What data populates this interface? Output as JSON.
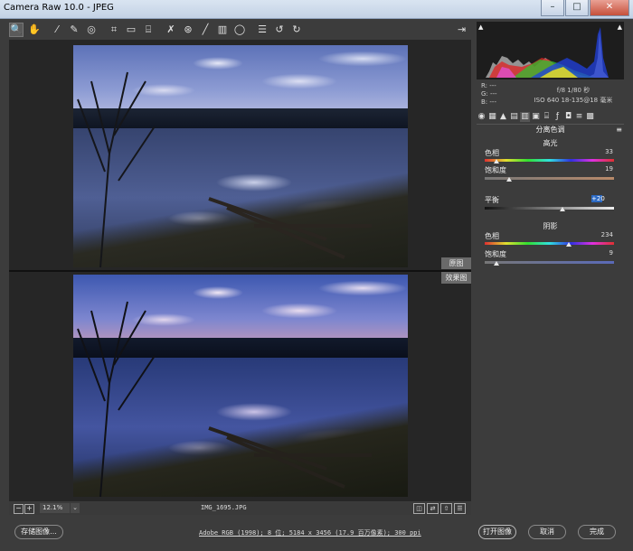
{
  "window": {
    "title": "Camera Raw 10.0 - JPEG",
    "buttons": [
      "–",
      "□",
      "✕"
    ]
  },
  "toolbar": {
    "tools": [
      {
        "name": "zoom-tool",
        "glyph": "🔍"
      },
      {
        "name": "hand-tool",
        "glyph": "✋"
      },
      {
        "name": "white-balance-tool",
        "glyph": "⁄"
      },
      {
        "name": "color-sampler-tool",
        "glyph": "✎"
      },
      {
        "name": "targeted-adjustment-tool",
        "glyph": "◎"
      },
      {
        "name": "crop-tool",
        "glyph": "⌗"
      },
      {
        "name": "straighten-tool",
        "glyph": "▭"
      },
      {
        "name": "transform-tool",
        "glyph": "⌸"
      },
      {
        "name": "spot-removal-tool",
        "glyph": "✗"
      },
      {
        "name": "red-eye-tool",
        "glyph": "⊛"
      },
      {
        "name": "adjustment-brush-tool",
        "glyph": "╱"
      },
      {
        "name": "graduated-filter-tool",
        "glyph": "▥"
      },
      {
        "name": "radial-filter-tool",
        "glyph": "◯"
      },
      {
        "name": "preferences-icon",
        "glyph": "☰"
      },
      {
        "name": "rotate-ccw-icon",
        "glyph": "↺"
      },
      {
        "name": "rotate-cw-icon",
        "glyph": "↻"
      }
    ]
  },
  "preview": {
    "before_label": "原图",
    "after_label": "效果图"
  },
  "statusbar": {
    "zoom": "12.1%",
    "filename": "IMG_1695.JPG",
    "minus": "−",
    "plus": "+"
  },
  "info": {
    "r": "R:  ---",
    "g": "G:  ---",
    "b": "B:  ---",
    "exposure": "f/8   1/80 秒",
    "iso": "ISO 640   18-135@18 毫米"
  },
  "panel": {
    "title": "分离色调",
    "highlights": {
      "heading": "高光",
      "hue_label": "色相",
      "hue_value": "33",
      "hue_pos": 0.09,
      "sat_label": "饱和度",
      "sat_value": "19",
      "sat_pos": 0.19
    },
    "balance": {
      "label": "平衡",
      "value": "+20",
      "pos": 0.6
    },
    "shadows": {
      "heading": "阴影",
      "hue_label": "色相",
      "hue_value": "234",
      "hue_pos": 0.65,
      "sat_label": "饱和度",
      "sat_value": "9",
      "sat_pos": 0.09
    }
  },
  "footer": {
    "save_label": "存储图像...",
    "file_info": "Adobe RGB (1998); 8 位; 5184 x 3456 (17.9 百万像素); 300 ppi",
    "open_label": "打开图像",
    "cancel_label": "取消",
    "done_label": "完成"
  },
  "colors": {
    "accent": "#2b69c2",
    "panel_bg": "#3c3c3c",
    "preview_bg": "#262626"
  }
}
